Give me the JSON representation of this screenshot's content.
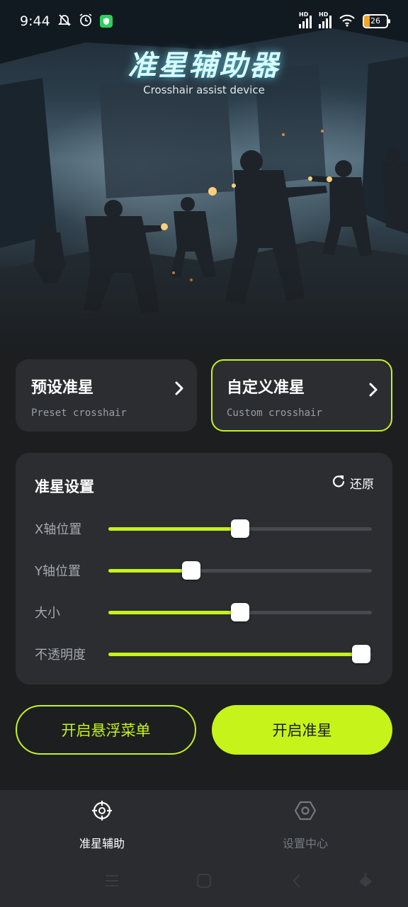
{
  "status_bar": {
    "time": "9:44",
    "battery": "26",
    "icons": [
      "mute-bell-icon",
      "alarm-icon",
      "shield-app-icon",
      "hd-signal-icon",
      "hd-signal-icon",
      "wifi-icon",
      "battery-icon"
    ]
  },
  "hero": {
    "title": "准星辅助器",
    "subtitle": "Crosshair assist device"
  },
  "modes": {
    "preset": {
      "title": "预设准星",
      "subtitle": "Preset crosshair",
      "icon": "chevron-right-icon"
    },
    "custom": {
      "title": "自定义准星",
      "subtitle": "Custom crosshair",
      "icon": "chevron-right-icon",
      "selected": true
    }
  },
  "settings": {
    "title": "准星设置",
    "reset_label": "还原",
    "reset_icon": "refresh-icon",
    "sliders": [
      {
        "label": "X轴位置",
        "value": 0.5
      },
      {
        "label": "Y轴位置",
        "value": 0.315
      },
      {
        "label": "大小",
        "value": 0.5
      },
      {
        "label": "不透明度",
        "value": 0.96
      }
    ]
  },
  "actions": {
    "floating_menu": "开启悬浮菜单",
    "start_crosshair": "开启准星"
  },
  "bottom_nav": [
    {
      "label": "准星辅助",
      "icon": "crosshair-icon",
      "active": true
    },
    {
      "label": "设置中心",
      "icon": "hexagon-settings-icon",
      "active": false
    }
  ],
  "colors": {
    "accent": "#c6f31a",
    "background": "#1c1e20",
    "card": "#2b2d30",
    "inactive_nav": "#75797e"
  }
}
